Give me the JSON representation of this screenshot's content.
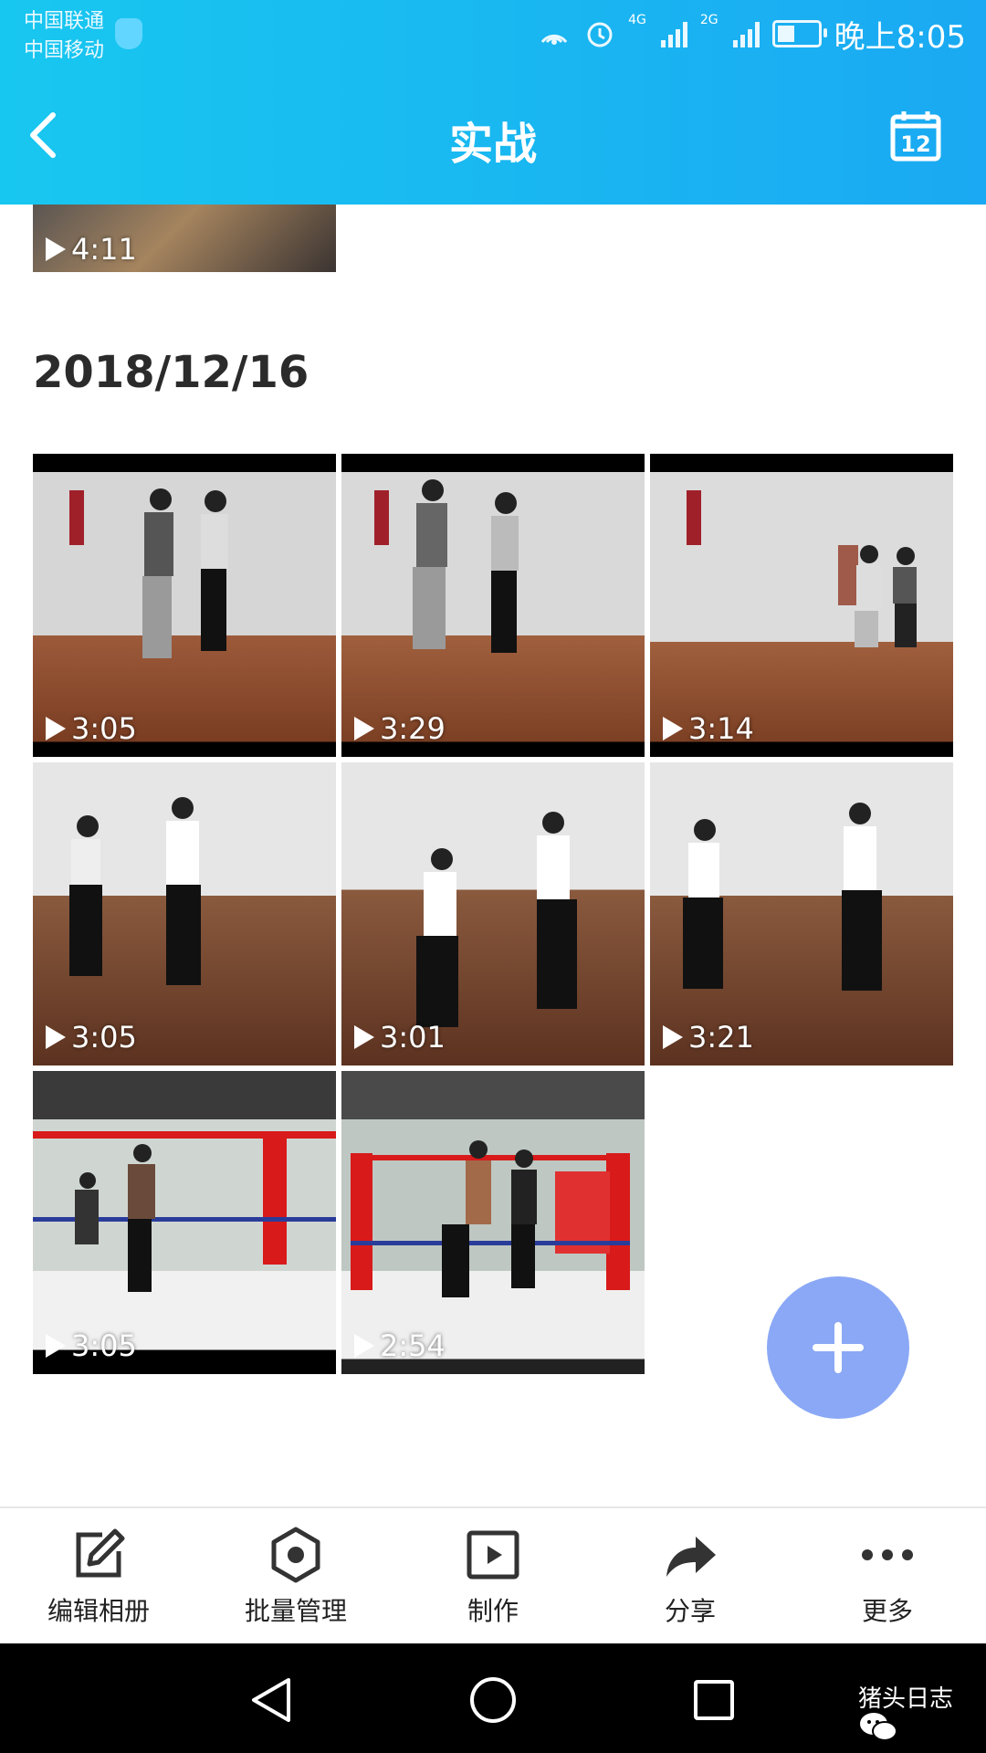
{
  "status_bar": {
    "carrier1": "中国联通",
    "carrier2": "中国移动",
    "network1": "4G",
    "network2": "2G",
    "time": "晚上8:05"
  },
  "header": {
    "title": "实战",
    "back_icon": "chevron-left-icon",
    "calendar_icon": "calendar-icon",
    "calendar_day": "12",
    "background": "#1ab4f2"
  },
  "album": {
    "previous_item": {
      "duration": "4:11"
    },
    "date": "2018/12/16",
    "videos": [
      {
        "duration": "3:05"
      },
      {
        "duration": "3:29"
      },
      {
        "duration": "3:14"
      },
      {
        "duration": "3:05"
      },
      {
        "duration": "3:01"
      },
      {
        "duration": "3:21"
      },
      {
        "duration": "3:05"
      },
      {
        "duration": "2:54"
      }
    ]
  },
  "fab": {
    "icon": "plus-icon",
    "color": "#8aa8f5"
  },
  "toolbar": [
    {
      "label": "编辑相册",
      "icon": "edit-icon"
    },
    {
      "label": "批量管理",
      "icon": "hexagon-select-icon"
    },
    {
      "label": "制作",
      "icon": "play-box-icon"
    },
    {
      "label": "分享",
      "icon": "share-arrow-icon"
    },
    {
      "label": "更多",
      "icon": "more-dots-icon"
    }
  ],
  "watermark": {
    "text": "猪头日志"
  }
}
